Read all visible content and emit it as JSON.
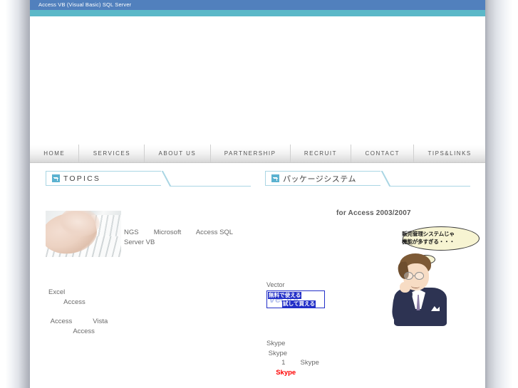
{
  "header": {
    "title": "Access VB (Visual Basic) SQL Server",
    "bar_color": "#5180bd",
    "accent_color": "#5bb8c8"
  },
  "nav": {
    "items": [
      {
        "label": "HOME"
      },
      {
        "label": "SERVICES"
      },
      {
        "label": "ABOUT US"
      },
      {
        "label": "PARTNERSHIP"
      },
      {
        "label": "RECRUIT"
      },
      {
        "label": "CONTACT"
      },
      {
        "label": "TIPS&LINKS"
      }
    ]
  },
  "left_column": {
    "section_title": "TOPICS",
    "section_icon": "arrow-right-icon",
    "photo_alt": "hands-typing-keyboard-photo",
    "intro_text": "NGS        Microsoft        Access SQL\nServer VB",
    "excel_text": "Excel\n        Access",
    "vista_text": " Access           Vista\n             Access"
  },
  "right_column": {
    "section_title": "パッケージシステム",
    "section_icon": "arrow-right-icon",
    "for_access": "for Access 2003/2007",
    "illustration": {
      "alt": "businessman-thinking-illustration",
      "bubble_line_1": "販売管理システムじゃ",
      "bubble_line_2": "機能が多すぎる・・・"
    },
    "vector": {
      "label": "Vector",
      "watermark": "Vector",
      "banner_line_1": "無料で使える",
      "banner_line_2": "試して買える",
      "border_color": "#2330c8"
    },
    "skype": {
      "line_1": "Skype",
      "line_2": " Skype",
      "line_3": "        1        Skype",
      "link_indent": "     ",
      "link_label": "Skype",
      "link_color": "#ff0000"
    }
  }
}
